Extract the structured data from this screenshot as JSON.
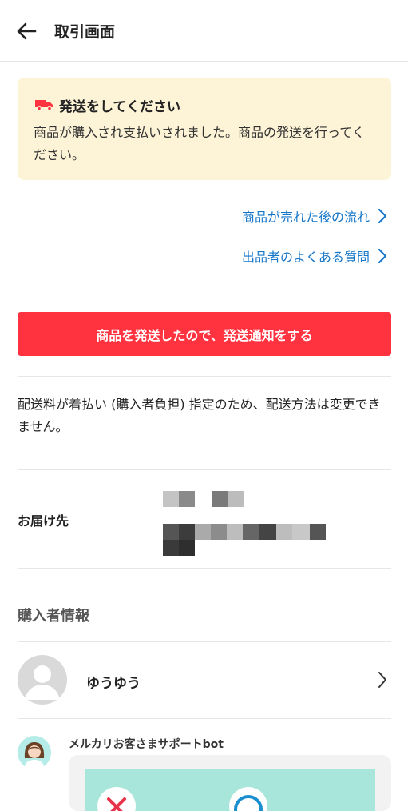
{
  "header": {
    "title": "取引画面",
    "back_icon": "arrow-left-icon"
  },
  "notice": {
    "icon": "truck-icon",
    "title": "発送をしてください",
    "body": "商品が購入され支払いされました。商品の発送を行ってください。",
    "background": "#fdf3d6"
  },
  "links": [
    {
      "label": "商品が売れた後の流れ"
    },
    {
      "label": "出品者のよくある質問"
    }
  ],
  "colors": {
    "accent": "#ff333f",
    "link": "#1677c9"
  },
  "action_button": {
    "label": "商品を発送したので、発送通知をする"
  },
  "shipping_info": "配送料が着払い (購入者負担) 指定のため、配送方法は変更できません。",
  "address": {
    "label": "お届け先"
  },
  "buyer_section": {
    "title": "購入者情報",
    "name": "ゆうゆう",
    "avatar_icon": "default-avatar-icon"
  },
  "bot": {
    "name": "メルカリお客さまサポートbot",
    "avatar_icon": "support-agent-avatar"
  }
}
